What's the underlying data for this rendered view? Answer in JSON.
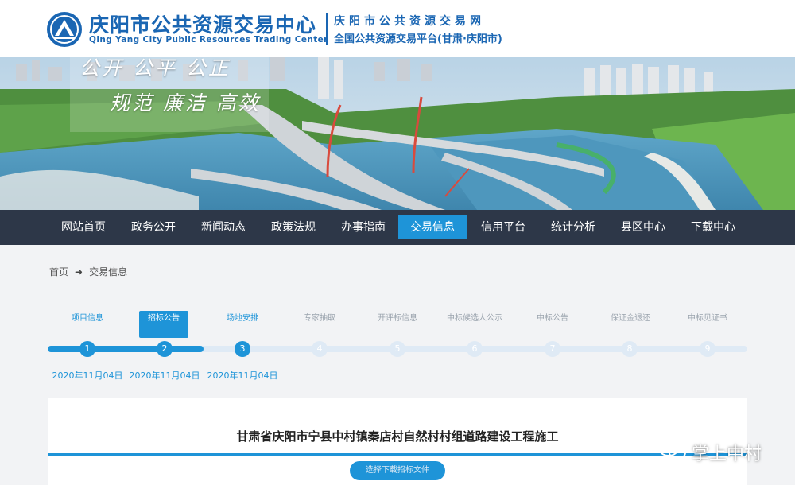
{
  "header": {
    "org_name_cn": "庆阳市公共资源交易中心",
    "org_name_en": "Qing Yang City Public Resources Trading Center",
    "site_name": "庆阳市公共资源交易网",
    "platform_name": "全国公共资源交易平台(甘肃·庆阳市)"
  },
  "banner": {
    "slogan_line1": "公开 公平 公正",
    "slogan_line2": "规范 廉洁 高效"
  },
  "nav": {
    "active_index": 5,
    "items": [
      {
        "label": "网站首页"
      },
      {
        "label": "政务公开"
      },
      {
        "label": "新闻动态"
      },
      {
        "label": "政策法规"
      },
      {
        "label": "办事指南"
      },
      {
        "label": "交易信息"
      },
      {
        "label": "信用平台"
      },
      {
        "label": "统计分析"
      },
      {
        "label": "县区中心"
      },
      {
        "label": "下载中心"
      }
    ]
  },
  "breadcrumb": {
    "home": "首页",
    "arrow": "➜",
    "current": "交易信息"
  },
  "steps": {
    "current_index": 1,
    "items": [
      {
        "label": "项目信息",
        "number": "1",
        "date": "2020年11月04日",
        "state": "done"
      },
      {
        "label": "招标公告",
        "number": "2",
        "date": "2020年11月04日",
        "state": "current"
      },
      {
        "label": "场地安排",
        "number": "3",
        "date": "2020年11月04日",
        "state": "done"
      },
      {
        "label": "专家抽取",
        "number": "4",
        "date": "",
        "state": "inactive"
      },
      {
        "label": "开评标信息",
        "number": "5",
        "date": "",
        "state": "inactive"
      },
      {
        "label": "中标候选人公示",
        "number": "6",
        "date": "",
        "state": "inactive"
      },
      {
        "label": "中标公告",
        "number": "7",
        "date": "",
        "state": "inactive"
      },
      {
        "label": "保证金退还",
        "number": "8",
        "date": "",
        "state": "inactive"
      },
      {
        "label": "中标见证书",
        "number": "9",
        "date": "",
        "state": "inactive"
      }
    ]
  },
  "content": {
    "project_title": "甘肃省庆阳市宁县中村镇秦店村自然村村组道路建设工程施工",
    "select_file_label": "选择下载招标文件"
  },
  "watermark": {
    "text": "掌上中村"
  },
  "colors": {
    "brand_blue": "#1a66b3",
    "accent_blue": "#1e94d8",
    "nav_bg": "#2d3748",
    "inactive_track": "#dfeaf5"
  }
}
